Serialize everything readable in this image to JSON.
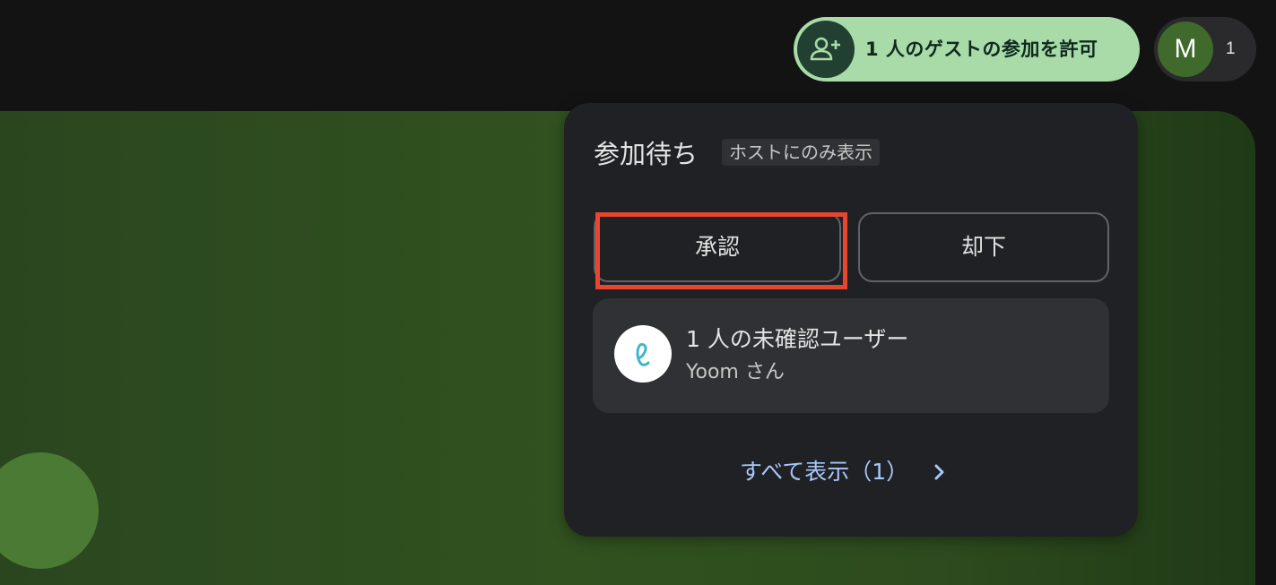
{
  "header": {
    "admit_chip": {
      "label": "1 人のゲストの参加を許可",
      "icon": "person-add-icon"
    },
    "participants": {
      "avatar_initial": "M",
      "count": "1"
    }
  },
  "panel": {
    "title": "参加待ち",
    "badge": "ホストにのみ表示",
    "approve_label": "承認",
    "deny_label": "却下",
    "user_card": {
      "line1": "1 人の未確認ユーザー",
      "line2": "Yoom さん",
      "avatar_icon": "yoom-logo-icon"
    },
    "view_all": "すべて表示（1）",
    "view_all_icon": "chevron-right-icon"
  },
  "colors": {
    "admit_chip_bg": "#a8dba8",
    "highlight": "#e8462f",
    "link": "#a8c7fa",
    "panel_bg": "#202124"
  }
}
